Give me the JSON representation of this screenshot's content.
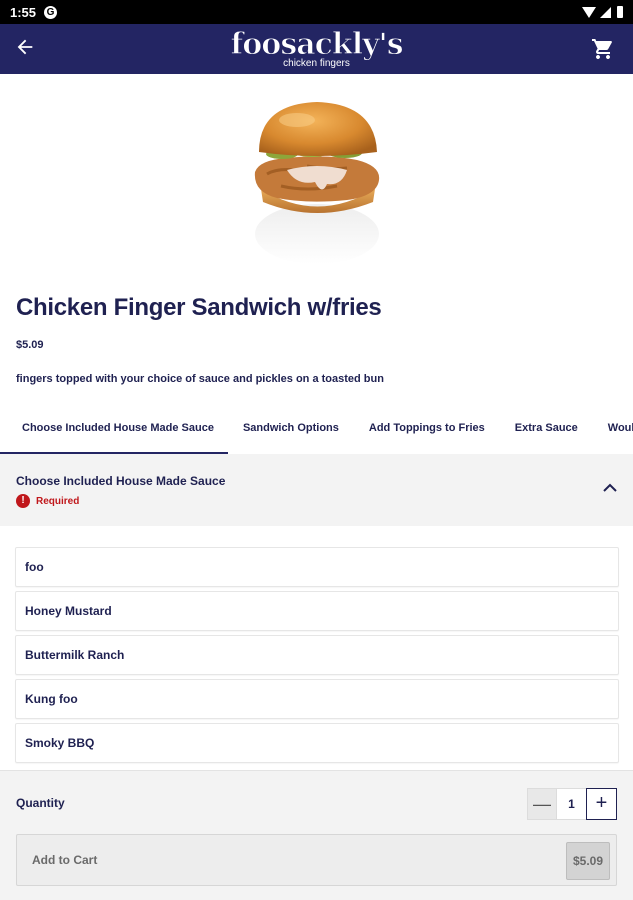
{
  "status_bar": {
    "time": "1:55",
    "badge": "G"
  },
  "app_bar": {
    "brand": "foosackly's",
    "tagline": "chicken fingers",
    "back_icon": "arrow-left-icon",
    "cart_icon": "cart-icon"
  },
  "product": {
    "title": "Chicken Finger Sandwich w/fries",
    "price": "$5.09",
    "description": "fingers topped with your choice of sauce and pickles on a toasted bun"
  },
  "tabs": [
    {
      "label": "Choose Included House Made Sauce",
      "active": true
    },
    {
      "label": "Sandwich Options"
    },
    {
      "label": "Add Toppings to Fries"
    },
    {
      "label": "Extra Sauce"
    },
    {
      "label": "Would you"
    }
  ],
  "section": {
    "title": "Choose Included House Made Sauce",
    "required_label": "Required",
    "required_icon": "alert-icon"
  },
  "options": [
    "foo",
    "Honey Mustard",
    "Buttermilk Ranch",
    "Kung foo",
    "Smoky BBQ"
  ],
  "quantity": {
    "label": "Quantity",
    "value": "1",
    "minus": "—",
    "plus": "+"
  },
  "add_to_cart": {
    "label": "Add to Cart",
    "amount": "$5.09"
  },
  "colors": {
    "brand_navy": "#232563",
    "text_navy": "#1f2151",
    "required_red": "#c0171b"
  }
}
